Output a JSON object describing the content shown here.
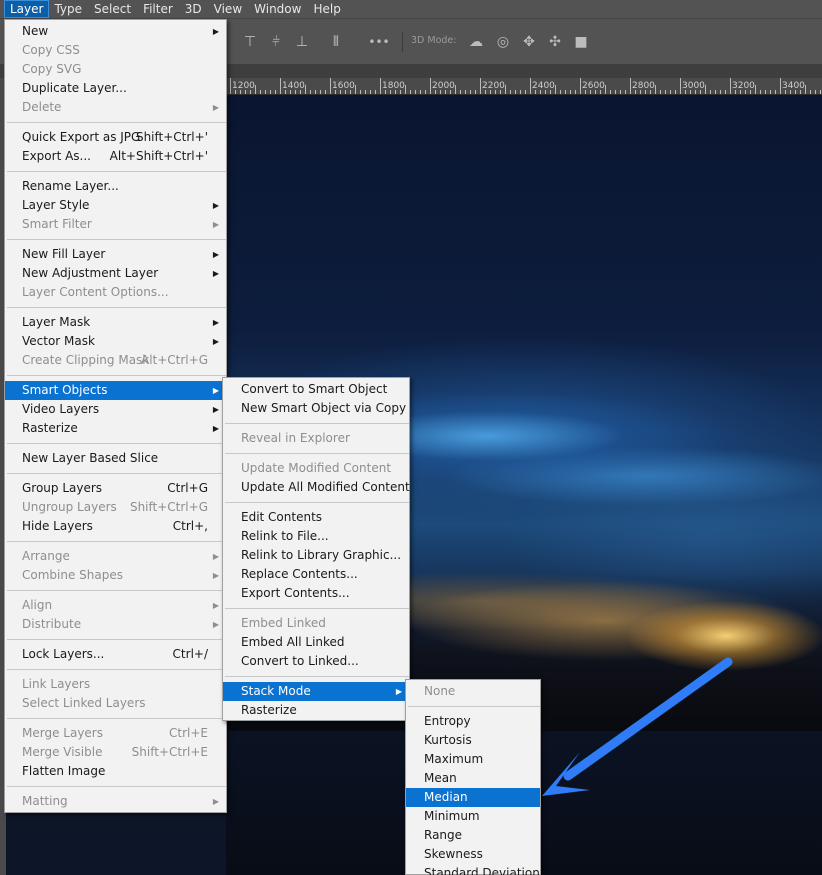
{
  "menubar": {
    "items": [
      "Layer",
      "Type",
      "Select",
      "Filter",
      "3D",
      "View",
      "Window",
      "Help"
    ],
    "active_index": 0
  },
  "options_bar": {
    "three_d_mode_label": "3D Mode:",
    "more_label": "•••"
  },
  "ruler": {
    "labels": [
      "1200",
      "1400",
      "1600",
      "1800",
      "2000",
      "2200",
      "2400",
      "2600",
      "2800",
      "3000",
      "3200",
      "3400"
    ]
  },
  "layer_menu": {
    "items": [
      {
        "label": "New",
        "submenu": true
      },
      {
        "label": "Copy CSS",
        "disabled": true
      },
      {
        "label": "Copy SVG",
        "disabled": true
      },
      {
        "label": "Duplicate Layer..."
      },
      {
        "label": "Delete",
        "disabled": true,
        "submenu": true
      },
      {
        "sep": true
      },
      {
        "label": "Quick Export as JPG",
        "shortcut": "Shift+Ctrl+'"
      },
      {
        "label": "Export As...",
        "shortcut": "Alt+Shift+Ctrl+'"
      },
      {
        "sep": true
      },
      {
        "label": "Rename Layer..."
      },
      {
        "label": "Layer Style",
        "submenu": true
      },
      {
        "label": "Smart Filter",
        "disabled": true,
        "submenu": true
      },
      {
        "sep": true
      },
      {
        "label": "New Fill Layer",
        "submenu": true
      },
      {
        "label": "New Adjustment Layer",
        "submenu": true
      },
      {
        "label": "Layer Content Options...",
        "disabled": true
      },
      {
        "sep": true
      },
      {
        "label": "Layer Mask",
        "submenu": true
      },
      {
        "label": "Vector Mask",
        "submenu": true
      },
      {
        "label": "Create Clipping Mask",
        "disabled": true,
        "shortcut": "Alt+Ctrl+G"
      },
      {
        "sep": true
      },
      {
        "label": "Smart Objects",
        "submenu": true,
        "highlight": true
      },
      {
        "label": "Video Layers",
        "submenu": true
      },
      {
        "label": "Rasterize",
        "submenu": true
      },
      {
        "sep": true
      },
      {
        "label": "New Layer Based Slice"
      },
      {
        "sep": true
      },
      {
        "label": "Group Layers",
        "shortcut": "Ctrl+G"
      },
      {
        "label": "Ungroup Layers",
        "disabled": true,
        "shortcut": "Shift+Ctrl+G"
      },
      {
        "label": "Hide Layers",
        "shortcut": "Ctrl+,"
      },
      {
        "sep": true
      },
      {
        "label": "Arrange",
        "disabled": true,
        "submenu": true
      },
      {
        "label": "Combine Shapes",
        "disabled": true,
        "submenu": true
      },
      {
        "sep": true
      },
      {
        "label": "Align",
        "disabled": true,
        "submenu": true
      },
      {
        "label": "Distribute",
        "disabled": true,
        "submenu": true
      },
      {
        "sep": true
      },
      {
        "label": "Lock Layers...",
        "shortcut": "Ctrl+/"
      },
      {
        "sep": true
      },
      {
        "label": "Link Layers",
        "disabled": true
      },
      {
        "label": "Select Linked Layers",
        "disabled": true
      },
      {
        "sep": true
      },
      {
        "label": "Merge Layers",
        "disabled": true,
        "shortcut": "Ctrl+E"
      },
      {
        "label": "Merge Visible",
        "disabled": true,
        "shortcut": "Shift+Ctrl+E"
      },
      {
        "label": "Flatten Image"
      },
      {
        "sep": true
      },
      {
        "label": "Matting",
        "disabled": true,
        "submenu": true
      }
    ]
  },
  "smart_objects_menu": {
    "items": [
      {
        "label": "Convert to Smart Object"
      },
      {
        "label": "New Smart Object via Copy"
      },
      {
        "sep": true
      },
      {
        "label": "Reveal in Explorer",
        "disabled": true
      },
      {
        "sep": true
      },
      {
        "label": "Update Modified Content",
        "disabled": true
      },
      {
        "label": "Update All Modified Content"
      },
      {
        "sep": true
      },
      {
        "label": "Edit Contents"
      },
      {
        "label": "Relink to File..."
      },
      {
        "label": "Relink to Library Graphic..."
      },
      {
        "label": "Replace Contents..."
      },
      {
        "label": "Export Contents..."
      },
      {
        "sep": true
      },
      {
        "label": "Embed Linked",
        "disabled": true
      },
      {
        "label": "Embed All Linked"
      },
      {
        "label": "Convert to Linked..."
      },
      {
        "sep": true
      },
      {
        "label": "Stack Mode",
        "submenu": true,
        "highlight": true
      },
      {
        "label": "Rasterize"
      }
    ]
  },
  "stack_mode_menu": {
    "items": [
      {
        "label": "None",
        "disabled": true
      },
      {
        "sep": true
      },
      {
        "label": "Entropy"
      },
      {
        "label": "Kurtosis"
      },
      {
        "label": "Maximum"
      },
      {
        "label": "Mean"
      },
      {
        "label": "Median",
        "highlight": true
      },
      {
        "label": "Minimum"
      },
      {
        "label": "Range"
      },
      {
        "label": "Skewness"
      },
      {
        "label": "Standard Deviation"
      }
    ]
  },
  "colors": {
    "highlight": "#0a72d1",
    "arrow": "#2f7cf6"
  }
}
